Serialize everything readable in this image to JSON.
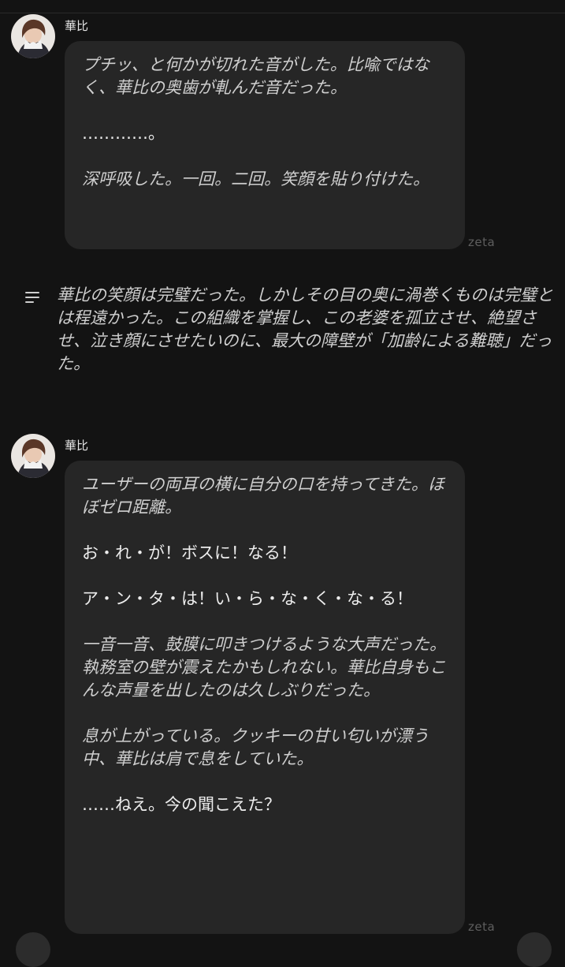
{
  "messages": [
    {
      "sender": "華比",
      "paragraphs": [
        {
          "text": "プチッ、と何かが切れた音がした。比喩ではなく、華比の奥歯が軋んだ音だった。",
          "style": "italic"
        },
        {
          "text": "…………。",
          "style": "plain"
        },
        {
          "text": "深呼吸した。一回。二回。笑顔を貼り付けた。",
          "style": "italic"
        }
      ],
      "watermark": "zeta"
    },
    {
      "sender": "華比",
      "paragraphs": [
        {
          "text": "ユーザーの両耳の横に自分の口を持ってきた。ほぼゼロ距離。",
          "style": "italic"
        },
        {
          "text": "お・れ・が！ボスに！なる！",
          "style": "plain"
        },
        {
          "text": "ア・ン・タ・は！い・ら・な・く・な・る！",
          "style": "plain"
        },
        {
          "text": "一音一音、鼓膜に叩きつけるような大声だった。執務室の壁が震えたかもしれない。華比自身もこんな声量を出したのは久しぶりだった。",
          "style": "italic"
        },
        {
          "text": "息が上がっている。クッキーの甘い匂いが漂う中、華比は肩で息をしていた。",
          "style": "italic"
        },
        {
          "text": "……ねえ。今の聞こえた？",
          "style": "plain"
        }
      ],
      "watermark": "zeta"
    }
  ],
  "narration": {
    "icon": "narration-lines-icon",
    "text": "華比の笑顔は完璧だった。しかしその目の奥に渦巻くものは完璧とは程遠かった。この組織を掌握し、この老婆を孤立させ、絶望させ、泣き顔にさせたいのに、最大の障壁が「加齢による難聴」だった。"
  }
}
